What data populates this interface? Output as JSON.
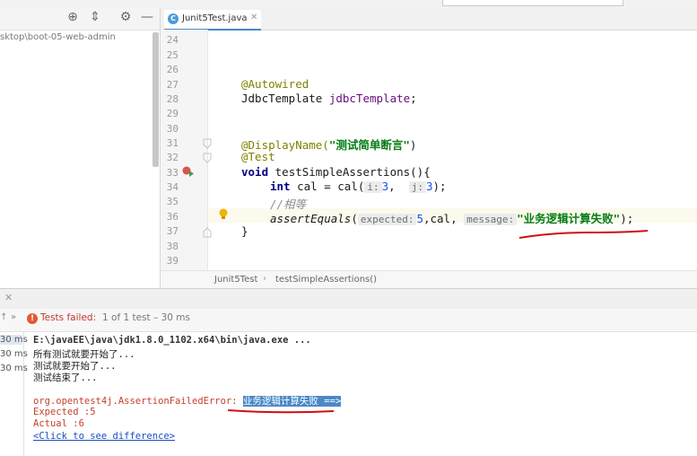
{
  "editor": {
    "tab_label": "Junit5Test.java",
    "tab_icon": "C",
    "lines": [
      {
        "n": "24"
      },
      {
        "n": "25"
      },
      {
        "n": "26"
      },
      {
        "n": "27"
      },
      {
        "n": "28"
      },
      {
        "n": "29"
      },
      {
        "n": "30"
      },
      {
        "n": "31"
      },
      {
        "n": "32"
      },
      {
        "n": "33"
      },
      {
        "n": "34"
      },
      {
        "n": "35"
      },
      {
        "n": "36"
      },
      {
        "n": "37"
      },
      {
        "n": "38"
      },
      {
        "n": "39"
      }
    ],
    "code": {
      "l27": "@Autowired",
      "l28_type": "JdbcTemplate ",
      "l28_field": "jdbcTemplate",
      "l28_end": ";",
      "l31_ann": "@DisplayName(",
      "l31_str": "\"测试简单断言\"",
      "l31_end": ")",
      "l32": "@Test",
      "l33_kw": "void ",
      "l33_rest": "testSimpleAssertions(){",
      "l34_kw": "int ",
      "l34_a": "cal = cal(",
      "l34_hint1": "i:",
      "l34_v1": "3",
      "l34_sep": ",  ",
      "l34_hint2": "j:",
      "l34_v2": "3",
      "l34_end": ");",
      "l35": "//相等",
      "l36_method": "assertEquals",
      "l36_open": "(",
      "l36_hint1": "expected:",
      "l36_v1": "5",
      "l36_mid": ",cal, ",
      "l36_hint2": "message:",
      "l36_str": "\"业务逻辑计算失败\"",
      "l36_end": ");",
      "l37": "}"
    },
    "breadcrumb": [
      "Junit5Test",
      "testSimpleAssertions()"
    ]
  },
  "project": {
    "path": "sktop\\boot-05-web-admin"
  },
  "run": {
    "status_label": "Tests failed:",
    "status_count": "1 of 1 test – 30 ms",
    "timings": [
      "30 ms",
      "30 ms",
      "30 ms"
    ],
    "console": {
      "cmd": "E:\\javaEE\\java\\jdk1.8.0_1102.x64\\bin\\java.exe ...",
      "out1": "所有测试就要开始了...",
      "out2": "测试就要开始了...",
      "out3": "测试结束了...",
      "err_class": "org.opentest4j.AssertionFailedError: ",
      "err_msg": "业务逻辑计算失败 ==>",
      "expected": "Expected :5",
      "actual": "Actual   :6",
      "diff_link": "<Click to see difference>"
    }
  },
  "colors": {
    "annotation": "#808000",
    "keyword": "#000080",
    "string": "#067d17",
    "error": "#c4422e",
    "selection": "#4a88c7",
    "underline_mark": "#d01010"
  },
  "icons": [
    "target-icon",
    "collapse-icon",
    "gear-icon",
    "minimize-icon",
    "run-gutter-icon",
    "bulb-icon",
    "close-icon",
    "fail-icon"
  ]
}
